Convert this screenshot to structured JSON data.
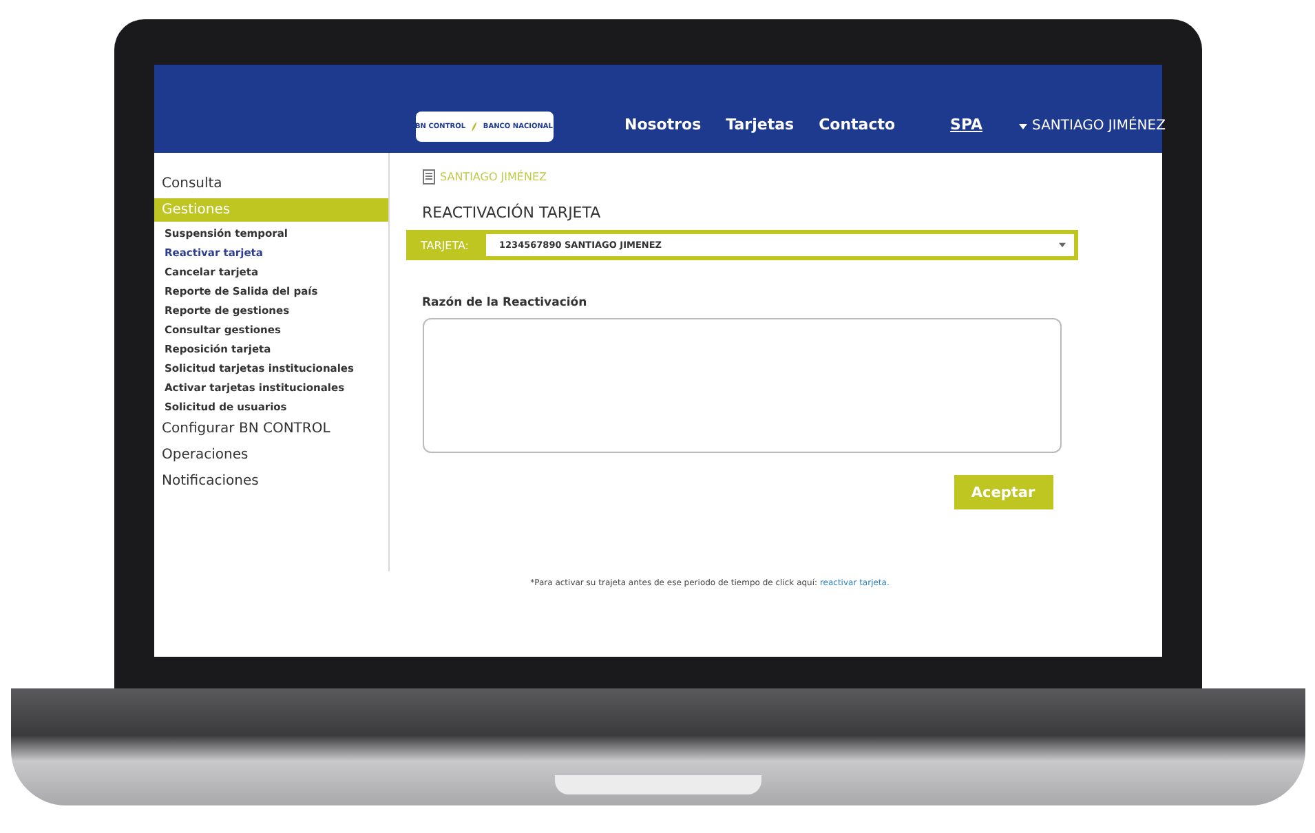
{
  "header": {
    "logo": {
      "product": "BN CONTROL",
      "bank": "BANCO NACIONAL"
    },
    "nav": [
      {
        "label": "Nosotros",
        "kind": "plain"
      },
      {
        "label": "Tarjetas",
        "kind": "plain"
      },
      {
        "label": "Contacto",
        "kind": "plain"
      },
      {
        "label": "SPA",
        "kind": "underlined"
      }
    ],
    "user": "SANTIAGO JIMÉNEZ"
  },
  "sidebar": {
    "items": [
      {
        "label": "Consulta",
        "selected": false
      },
      {
        "label": "Gestiones",
        "selected": true,
        "children": [
          {
            "label": "Suspensión temporal",
            "selected": false
          },
          {
            "label": "Reactivar tarjeta",
            "selected": true
          },
          {
            "label": "Cancelar tarjeta",
            "selected": false
          },
          {
            "label": "Reporte de Salida del país",
            "selected": false
          },
          {
            "label": "Reporte de gestiones",
            "selected": false
          },
          {
            "label": "Consultar gestiones",
            "selected": false
          },
          {
            "label": "Reposición tarjeta",
            "selected": false
          },
          {
            "label": "Solicitud tarjetas institucionales",
            "selected": false
          },
          {
            "label": "Activar tarjetas institucionales",
            "selected": false
          },
          {
            "label": "Solicitud de usuarios",
            "selected": false
          }
        ]
      },
      {
        "label": "Configurar BN CONTROL",
        "selected": false
      },
      {
        "label": "Operaciones",
        "selected": false
      },
      {
        "label": "Notificaciones",
        "selected": false
      }
    ]
  },
  "main": {
    "client": "SANTIAGO JIMÉNEZ",
    "title": "REACTIVACIÓN TARJETA",
    "card_select": {
      "label": "TARJETA:",
      "value": "1234567890 SANTIAGO JIMENEZ"
    },
    "reason": {
      "label": "Razón de la Reactivación"
    },
    "submit": "Aceptar",
    "note": {
      "text": "*Para activar su trajeta antes de ese periodo de tiempo de click aquí: ",
      "link": "reactivar tarjeta."
    }
  }
}
